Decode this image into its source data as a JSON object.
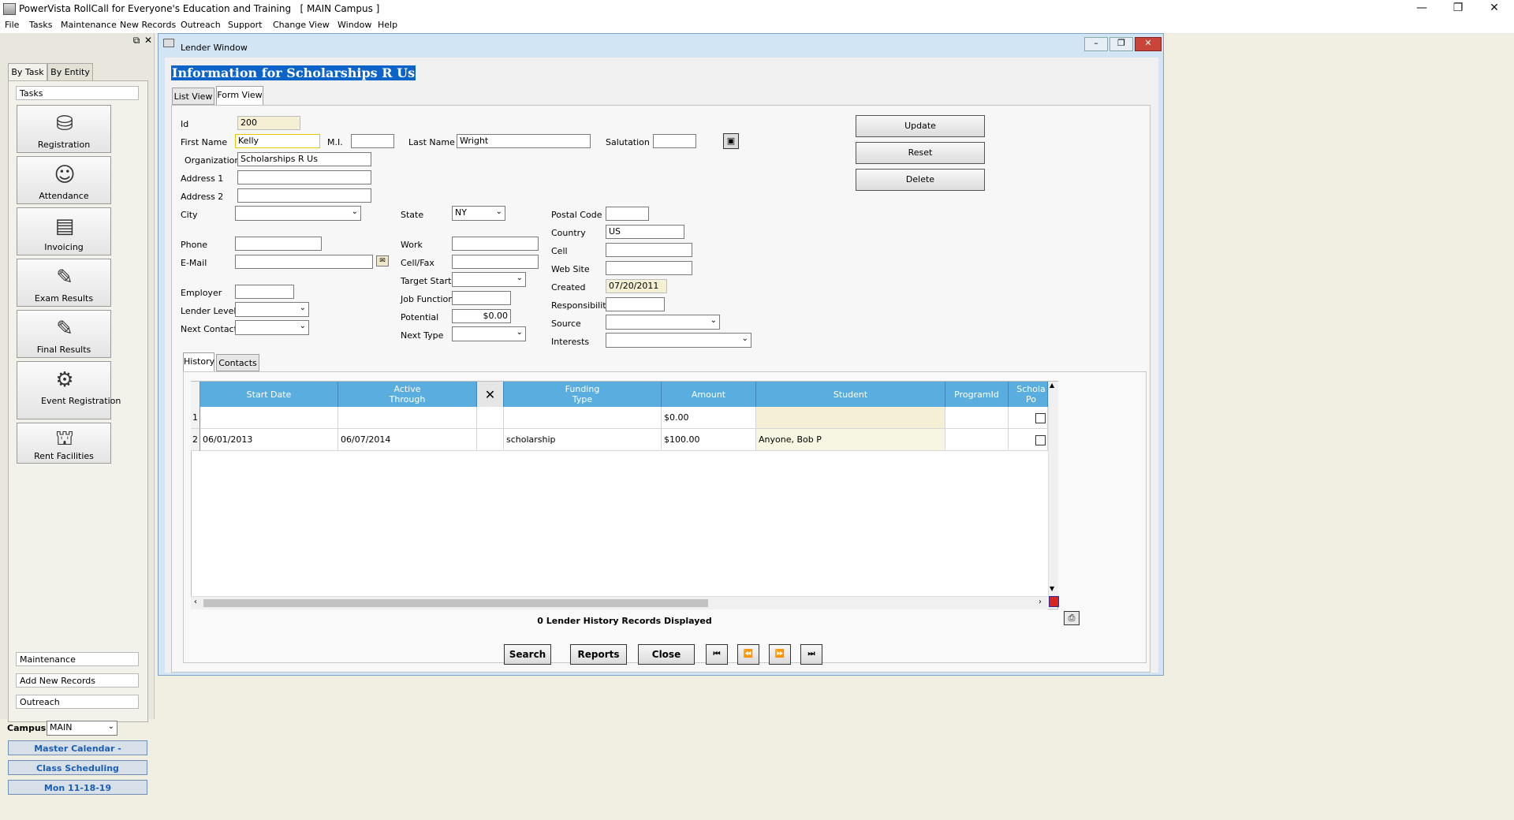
{
  "app": {
    "title": "PowerVista RollCall for Everyone's Education and Training   [ MAIN Campus ]",
    "window_controls": {
      "minimize": "—",
      "restore": "❐",
      "close": "✕"
    }
  },
  "menubar": [
    "File",
    "Tasks",
    "Maintenance",
    "New Records",
    "Outreach",
    "Support",
    "Change View",
    "Window",
    "Help"
  ],
  "left_panel": {
    "pin": "⧉",
    "close": "✕",
    "tabs": [
      "By Task",
      "By Entity"
    ],
    "section_header": "Tasks",
    "tasks": [
      {
        "label": "Registration",
        "icon": "registration-icon"
      },
      {
        "label": "Attendance",
        "icon": "attendance-icon"
      },
      {
        "label": "Invoicing",
        "icon": "invoicing-icon"
      },
      {
        "label": "Exam Results",
        "icon": "exam-results-icon"
      },
      {
        "label": "Final Results",
        "icon": "final-results-icon"
      },
      {
        "label": "Event Registration",
        "icon": "event-registration-icon"
      },
      {
        "label": "Rent Facilities",
        "icon": "rent-facilities-icon"
      }
    ],
    "bottom_sections": [
      "Maintenance",
      "Add New Records",
      "Outreach"
    ],
    "campus_label": "Campus",
    "campus_value": "MAIN",
    "quick_buttons": [
      "Master Calendar - November",
      "Class Scheduling",
      "Mon 11-18-19"
    ]
  },
  "lender_window": {
    "title": "Lender Window",
    "heading": "Information for Scholarships R Us",
    "view_tabs": [
      "List View",
      "Form View"
    ],
    "fields": {
      "id": {
        "label": "Id",
        "value": "200"
      },
      "first_name": {
        "label": "First Name",
        "value": "Kelly"
      },
      "mi": {
        "label": "M.I.",
        "value": ""
      },
      "last_name": {
        "label": "Last Name",
        "value": "Wright"
      },
      "salutation": {
        "label": "Salutation",
        "value": ""
      },
      "organization": {
        "label": "Organization",
        "value": "Scholarships R Us"
      },
      "address1": {
        "label": "Address 1",
        "value": ""
      },
      "address2": {
        "label": "Address 2",
        "value": ""
      },
      "city": {
        "label": "City",
        "value": ""
      },
      "state": {
        "label": "State",
        "value": "NY"
      },
      "postal_code": {
        "label": "Postal Code",
        "value": ""
      },
      "country": {
        "label": "Country",
        "value": "US"
      },
      "phone": {
        "label": "Phone",
        "value": ""
      },
      "work": {
        "label": "Work",
        "value": ""
      },
      "cell": {
        "label": "Cell",
        "value": ""
      },
      "email": {
        "label": "E-Mail",
        "value": ""
      },
      "cellfax": {
        "label": "Cell/Fax",
        "value": ""
      },
      "website": {
        "label": "Web Site",
        "value": ""
      },
      "target_start": {
        "label": "Target Start",
        "value": ""
      },
      "created": {
        "label": "Created",
        "value": "07/20/2011"
      },
      "employer": {
        "label": "Employer",
        "value": ""
      },
      "job_function": {
        "label": "Job Function",
        "value": ""
      },
      "responsibility": {
        "label": "Responsibility",
        "value": ""
      },
      "lender_level": {
        "label": "Lender Level",
        "value": ""
      },
      "potential": {
        "label": "Potential",
        "value": "$0.00"
      },
      "source": {
        "label": "Source",
        "value": ""
      },
      "next_contact": {
        "label": "Next Contact",
        "value": ""
      },
      "next_type": {
        "label": "Next Type",
        "value": ""
      },
      "interests": {
        "label": "Interests",
        "value": ""
      }
    },
    "actions": [
      "Update",
      "Reset",
      "Delete"
    ],
    "sub_tabs": [
      "History",
      "Contacts"
    ],
    "grid": {
      "columns": [
        "Start Date",
        "Active Through",
        "✕",
        "Funding Type",
        "Amount",
        "Student",
        "ProgramId",
        "Schola Po"
      ],
      "rows": [
        {
          "num": "1",
          "start": "",
          "through": "",
          "x": "",
          "funding": "",
          "amount": "$0.00",
          "student": "",
          "program": ""
        },
        {
          "num": "2",
          "start": "06/01/2013",
          "through": "06/07/2014",
          "x": "",
          "funding": "scholarship",
          "amount": "$100.00",
          "student": "Anyone, Bob P",
          "program": ""
        }
      ],
      "status": "0 Lender History Records Displayed"
    },
    "footer_buttons": [
      "Search",
      "Reports",
      "Close"
    ],
    "nav_buttons": [
      "⏮",
      "⏪",
      "⏩",
      "⏭"
    ]
  }
}
